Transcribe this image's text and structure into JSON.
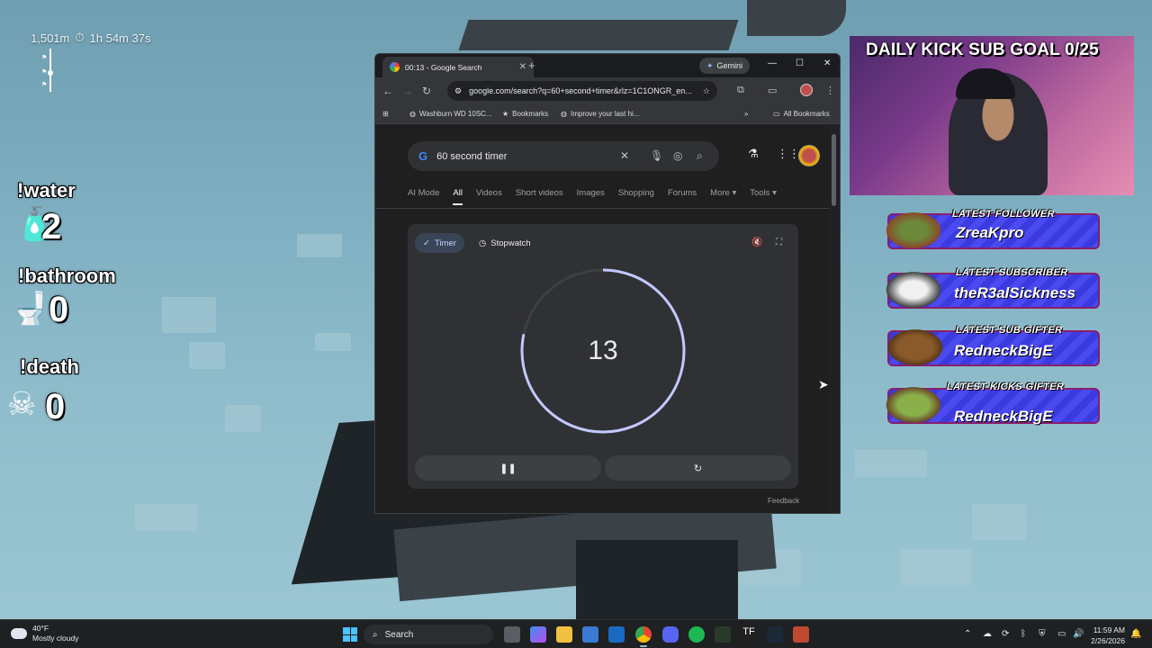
{
  "hud": {
    "distance": "1,501m",
    "time": "1h 54m 37s",
    "timer_icon": "stopwatch-icon"
  },
  "counters": {
    "water": {
      "label": "!water",
      "value": "2",
      "icon": "water-bottle-icon"
    },
    "bathroom": {
      "label": "!bathroom",
      "value": "0",
      "icon": "toilet-icon"
    },
    "death": {
      "label": "!death",
      "value": "0",
      "icon": "skull-crossbones-icon"
    }
  },
  "browser": {
    "tab_title": "00:13 - Google Search",
    "gemini_label": "Gemini",
    "url": "google.com/search?q=60+second+timer&rlz=1C1ONGR_en...",
    "bookmarks": [
      "Washburn WD 10SC...",
      "Bookmarks",
      "Improve your last hi..."
    ],
    "all_bookmarks": "All Bookmarks",
    "search_query": "60 second timer",
    "filters": [
      "AI Mode",
      "All",
      "Videos",
      "Short videos",
      "Images",
      "Shopping",
      "Forums",
      "More",
      "Tools"
    ],
    "active_filter": "All",
    "timer": {
      "tab_timer": "Timer",
      "tab_stopwatch": "Stopwatch",
      "remaining": "13",
      "total_seconds": 60,
      "progress_fraction": 0.217
    },
    "feedback": "Feedback"
  },
  "stream": {
    "goal": "DAILY KICK SUB GOAL 0/25",
    "alerts": [
      {
        "heading": "LATEST FOLLOWER",
        "name": "ZreaKpro"
      },
      {
        "heading": "LATEST SUBSCRIBER",
        "name": "theR3alSickness"
      },
      {
        "heading": "LATEST SUB GIFTER",
        "name": "RedneckBigE"
      },
      {
        "heading": "LATEST KICKS GIFTER",
        "name": "RedneckBigE"
      }
    ]
  },
  "taskbar": {
    "weather_temp": "40°F",
    "weather_desc": "Mostly cloudy",
    "search_label": "Search",
    "time": "11:59 AM",
    "date": "2/26/2026"
  },
  "colors": {
    "accent_blue": "#8ab4f8",
    "alert_purple": "#3b3adf",
    "dial_ring": "#c2c8ff"
  }
}
